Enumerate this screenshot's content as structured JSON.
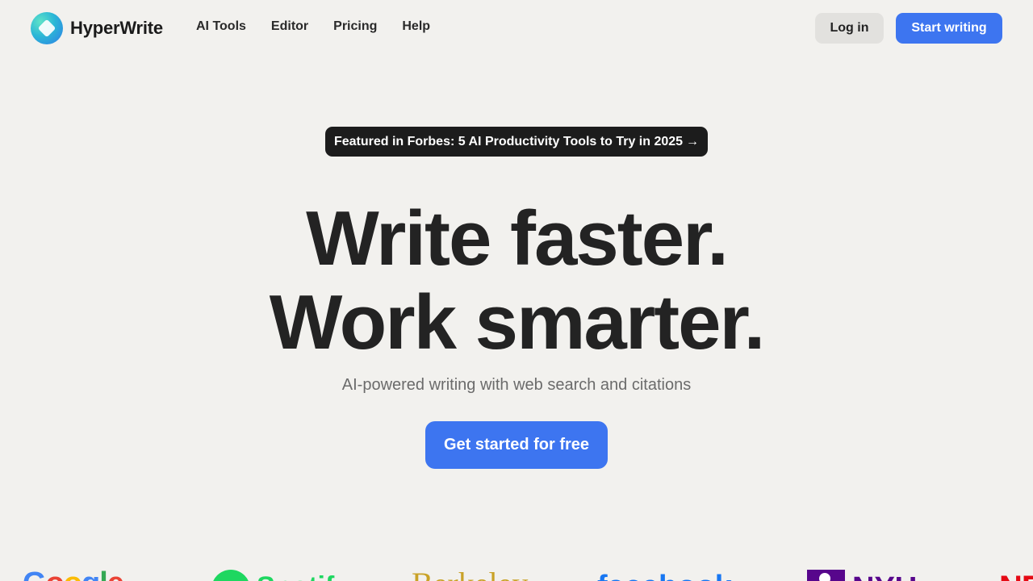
{
  "header": {
    "brand": "HyperWrite",
    "nav": [
      {
        "label": "AI Tools"
      },
      {
        "label": "Editor"
      },
      {
        "label": "Pricing"
      },
      {
        "label": "Help"
      }
    ],
    "login_label": "Log in",
    "start_label": "Start writing"
  },
  "hero": {
    "badge_text": "Featured in Forbes: 5 AI Productivity Tools to Try in 2025",
    "badge_arrow": "→",
    "headline_line1": "Write faster.",
    "headline_line2": "Work smarter.",
    "subhead": "AI-powered writing with web search and citations",
    "cta_label": "Get started for free"
  },
  "logos": {
    "google": [
      "G",
      "o",
      "o",
      "g",
      "l",
      "e"
    ],
    "spotify": "Spotify",
    "berkeley": "Berkeley",
    "facebook": "facebook",
    "nyu": "NYU",
    "netflix": "NETFLIX"
  },
  "colors": {
    "background": "#f2f1ee",
    "accent": "#3d75f0",
    "badge_bg": "#1c1c1c",
    "login_bg": "#e2e1de"
  },
  "icons": {
    "logo": "hyperwrite-logo-icon",
    "badge_arrow": "right-arrow-icon"
  }
}
